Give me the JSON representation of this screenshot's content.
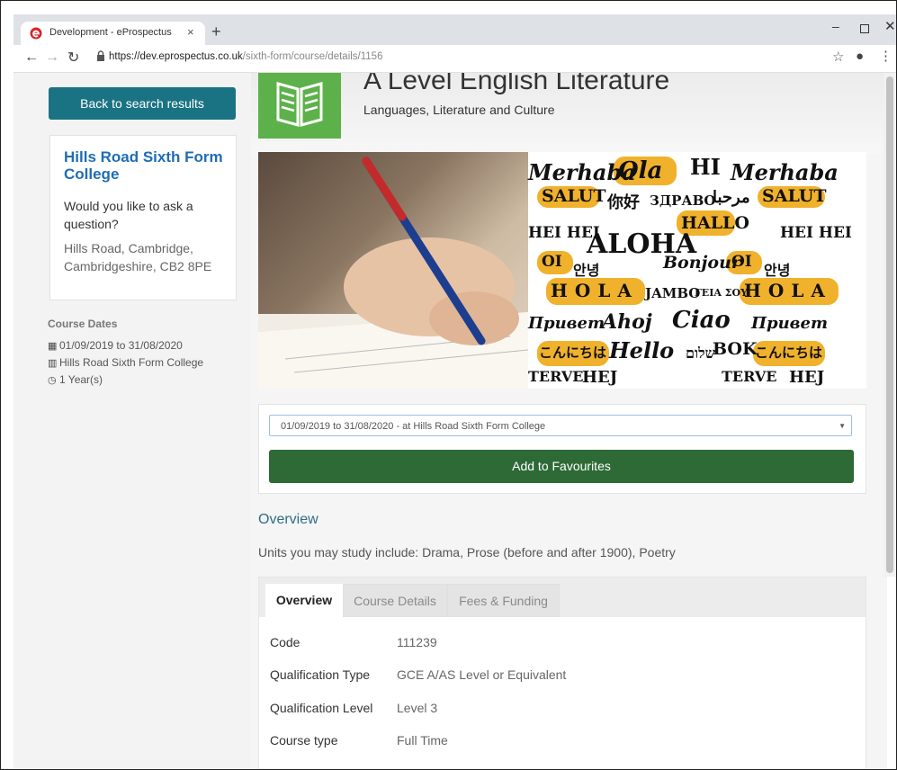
{
  "browser": {
    "tab_title": "Development - eProspectus",
    "tab_close": "×",
    "new_tab": "+",
    "url_host": "https://dev.eprospectus.co.uk",
    "url_path": "/sixth-form/course/details/1156"
  },
  "sidebar": {
    "back_button": "Back to search results",
    "college_name": "Hills Road Sixth Form College",
    "ask": "Would you like to ask a question?",
    "address": "Hills Road, Cambridge, Cambridgeshire, CB2 8PE",
    "course_dates_heading": "Course Dates",
    "date_range": "01/09/2019 to 31/08/2020",
    "location": "Hills Road Sixth Form College",
    "duration": "1 Year(s)"
  },
  "course": {
    "title": "A Level English Literature",
    "subtitle": "Languages, Literature and Culture",
    "date_select": "01/09/2019 to 31/08/2020 - at Hills Road Sixth Form College",
    "favourites_button": "Add to Favourites",
    "overview_heading": "Overview",
    "overview_text": "Units you may study include: Drama, Prose (before and after 1900), Poetry"
  },
  "tabs": [
    "Overview",
    "Course Details",
    "Fees & Funding"
  ],
  "details": [
    {
      "label": "Code",
      "value": "111239"
    },
    {
      "label": "Qualification Type",
      "value": "GCE A/AS Level or Equivalent"
    },
    {
      "label": "Qualification Level",
      "value": "Level 3"
    },
    {
      "label": "Course type",
      "value": "Full Time"
    }
  ],
  "hero_words": [
    "Merhaba",
    "Ola",
    "HI",
    "Merhaba",
    "SALUT",
    "你好",
    "ЗДРАВО",
    "مرحبا",
    "SALUT",
    "HEI HEI",
    "ALOHA",
    "HALLO",
    "HEI HEI",
    "OI",
    "안녕",
    "Bonjour",
    "OI",
    "안녕",
    "HOLA",
    "JAMBO",
    "ΓΕΙΑ ΣΟΥ",
    "HOLA",
    "Привет",
    "Ahoj",
    "Ciao",
    "Привет",
    "こんにちは",
    "Hello",
    "שלום",
    "BOK",
    "こんにちは",
    "TERVE",
    "HEJ",
    "TERVE",
    "HEJ"
  ],
  "colors": {
    "accent": "#1a7383",
    "favourites": "#2d6a35",
    "link": "#1f6db5",
    "tile": "#5db14a"
  }
}
